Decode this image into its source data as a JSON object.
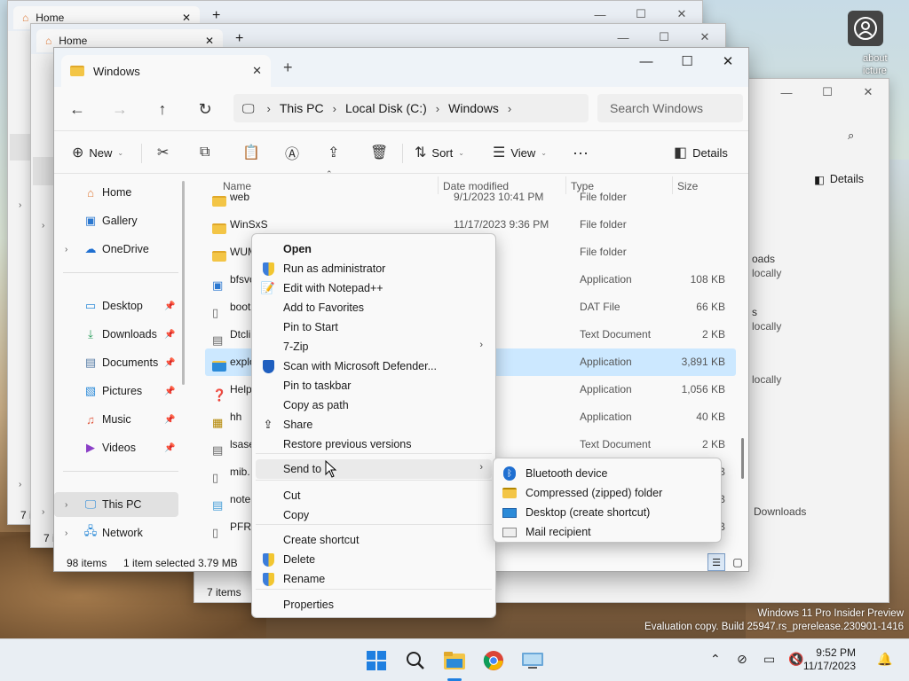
{
  "bg_windows": {
    "win1": {
      "tab_title": "Home",
      "status": "7 i"
    },
    "win2": {
      "tab_title": "Home",
      "status": "7 i"
    },
    "right_win": {
      "details_label": "Details",
      "status": "7 items",
      "frags": [
        "oads",
        "locally",
        "s",
        "locally",
        "locally",
        "Downloads"
      ]
    }
  },
  "desktop": {
    "avatar_text": "about\nicture"
  },
  "main": {
    "tab_title": "Windows",
    "nav": {
      "breadcrumbs": [
        "This PC",
        "Local Disk (C:)",
        "Windows"
      ],
      "search_placeholder": "Search Windows"
    },
    "cmd": {
      "new": "New",
      "sort": "Sort",
      "view": "View",
      "details": "Details"
    },
    "sidebar": {
      "items": [
        {
          "label": "Home"
        },
        {
          "label": "Gallery"
        },
        {
          "label": "OneDrive"
        },
        {
          "label": "Desktop"
        },
        {
          "label": "Downloads"
        },
        {
          "label": "Documents"
        },
        {
          "label": "Pictures"
        },
        {
          "label": "Music"
        },
        {
          "label": "Videos"
        },
        {
          "label": "This PC"
        },
        {
          "label": "Network"
        }
      ]
    },
    "columns": {
      "name": "Name",
      "date": "Date modified",
      "type": "Type",
      "size": "Size"
    },
    "rows": [
      {
        "name": "web",
        "date": "9/1/2023 10:41 PM",
        "type": "File folder",
        "size": ""
      },
      {
        "name": "WinSxS",
        "date": "11/17/2023 9:36 PM",
        "type": "File folder",
        "size": ""
      },
      {
        "name": "WUM",
        "date": ":29 PM",
        "type": "File folder",
        "size": ""
      },
      {
        "name": "bfsvc",
        "date": ":24 PM",
        "type": "Application",
        "size": "108 KB"
      },
      {
        "name": "boot",
        "date": "9:22 PM",
        "type": "DAT File",
        "size": "66 KB"
      },
      {
        "name": "Dtcli",
        "date": ":33 PM",
        "type": "Text Document",
        "size": "2 KB"
      },
      {
        "name": "explo",
        "date": ":24 PM",
        "type": "Application",
        "size": "3,891 KB"
      },
      {
        "name": "Help",
        "date": ":24 PM",
        "type": "Application",
        "size": "1,056 KB"
      },
      {
        "name": "hh",
        "date": ":24 PM",
        "type": "Application",
        "size": "40 KB"
      },
      {
        "name": "lsase",
        "date": ":29 PM",
        "type": "Text Document",
        "size": "2 KB"
      },
      {
        "name": "mib.",
        "date": "",
        "type": "",
        "size": "KB"
      },
      {
        "name": "note",
        "date": "",
        "type": "",
        "size": "KB"
      },
      {
        "name": "PFRO",
        "date": "",
        "type": "",
        "size": "KB"
      }
    ],
    "status": {
      "count": "98 items",
      "selected": "1 item selected",
      "size": "3.79 MB"
    }
  },
  "context_menu": {
    "items": [
      "Open",
      "Run as administrator",
      "Edit with Notepad++",
      "Add to Favorites",
      "Pin to Start",
      "7-Zip",
      "Scan with Microsoft Defender...",
      "Pin to taskbar",
      "Copy as path",
      "Share",
      "Restore previous versions",
      "Send to",
      "Cut",
      "Copy",
      "Create shortcut",
      "Delete",
      "Rename",
      "Properties"
    ]
  },
  "send_to_menu": {
    "items": [
      "Bluetooth device",
      "Compressed (zipped) folder",
      "Desktop (create shortcut)",
      "Mail recipient"
    ]
  },
  "watermark": {
    "line1": "Windows 11 Pro Insider Preview",
    "line2": "Evaluation copy. Build 25947.rs_prerelease.230901-1416"
  },
  "taskbar": {
    "time": "9:52 PM",
    "date": "11/17/2023"
  }
}
